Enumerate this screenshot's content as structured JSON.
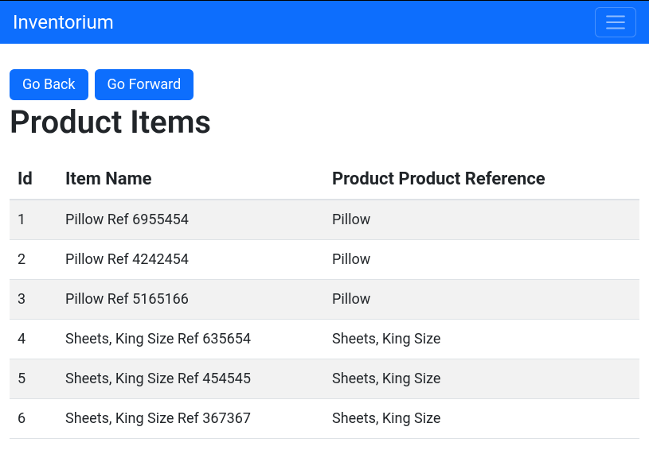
{
  "navbar": {
    "brand": "Inventorium"
  },
  "buttons": {
    "back": "Go Back",
    "forward": "Go Forward"
  },
  "page": {
    "title": "Product Items"
  },
  "table": {
    "headers": {
      "id": "Id",
      "item_name": "Item Name",
      "product_ref": "Product Product Reference"
    },
    "rows": [
      {
        "id": "1",
        "item_name": "Pillow Ref 6955454",
        "product_ref": "Pillow"
      },
      {
        "id": "2",
        "item_name": "Pillow Ref 4242454",
        "product_ref": "Pillow"
      },
      {
        "id": "3",
        "item_name": "Pillow Ref 5165166",
        "product_ref": "Pillow"
      },
      {
        "id": "4",
        "item_name": "Sheets, King Size Ref 635654",
        "product_ref": "Sheets, King Size"
      },
      {
        "id": "5",
        "item_name": "Sheets, King Size Ref 454545",
        "product_ref": "Sheets, King Size"
      },
      {
        "id": "6",
        "item_name": "Sheets, King Size Ref 367367",
        "product_ref": "Sheets, King Size"
      }
    ]
  }
}
